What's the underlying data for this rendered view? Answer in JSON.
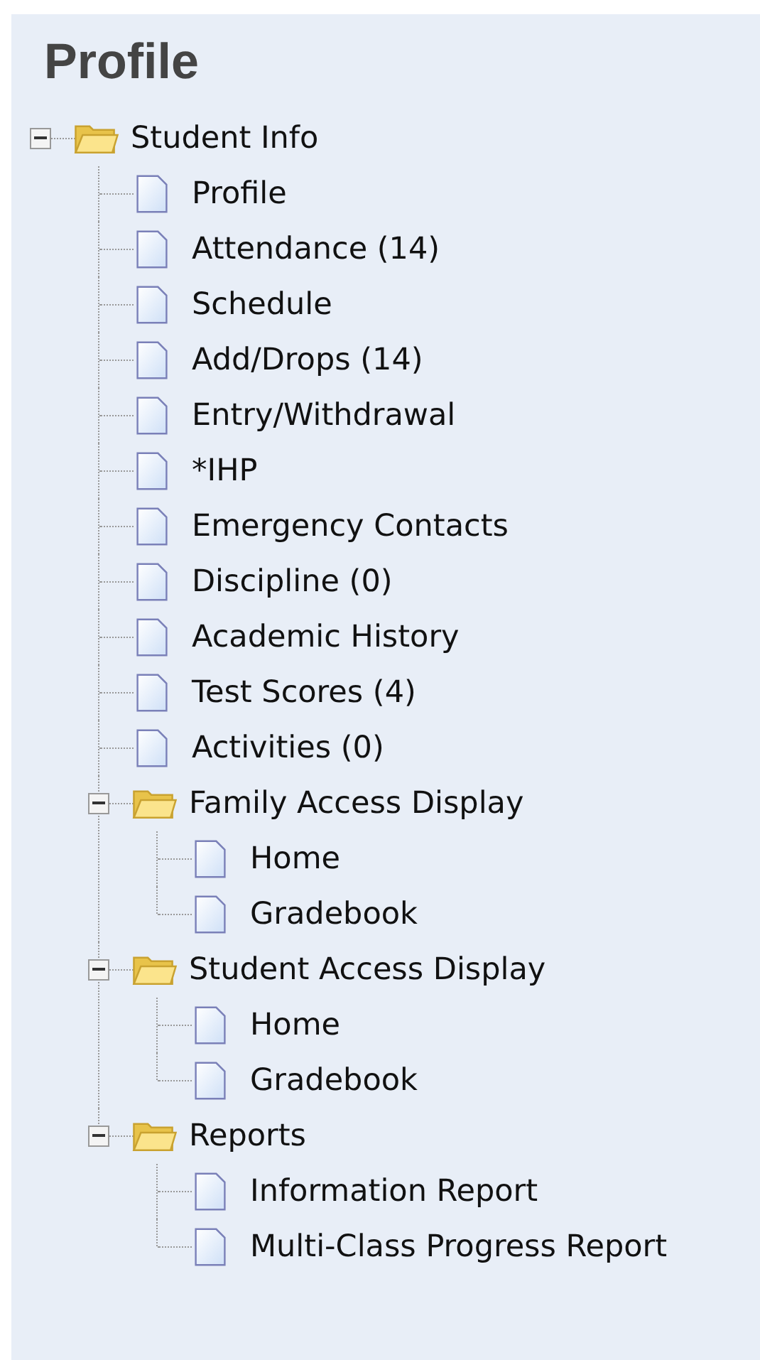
{
  "panel": {
    "title": "Profile"
  },
  "tree": [
    {
      "kind": "folder",
      "label": "Student Info",
      "expanded": true,
      "children": [
        {
          "kind": "page",
          "label": "Profile"
        },
        {
          "kind": "page",
          "label": "Attendance (14)"
        },
        {
          "kind": "page",
          "label": "Schedule"
        },
        {
          "kind": "page",
          "label": "Add/Drops (14)"
        },
        {
          "kind": "page",
          "label": "Entry/Withdrawal"
        },
        {
          "kind": "page",
          "label": "*IHP"
        },
        {
          "kind": "page",
          "label": "Emergency Contacts"
        },
        {
          "kind": "page",
          "label": "Discipline (0)"
        },
        {
          "kind": "page",
          "label": "Academic History"
        },
        {
          "kind": "page",
          "label": "Test Scores (4)"
        },
        {
          "kind": "page",
          "label": "Activities (0)"
        },
        {
          "kind": "folder",
          "label": "Family Access Display",
          "expanded": true,
          "children": [
            {
              "kind": "page",
              "label": "Home"
            },
            {
              "kind": "page",
              "label": "Gradebook"
            }
          ]
        },
        {
          "kind": "folder",
          "label": "Student Access Display",
          "expanded": true,
          "children": [
            {
              "kind": "page",
              "label": "Home"
            },
            {
              "kind": "page",
              "label": "Gradebook"
            }
          ]
        },
        {
          "kind": "folder",
          "label": "Reports",
          "expanded": true,
          "children": [
            {
              "kind": "page",
              "label": "Information Report"
            },
            {
              "kind": "page",
              "label": "Multi-Class Progress Report"
            }
          ]
        }
      ]
    }
  ]
}
